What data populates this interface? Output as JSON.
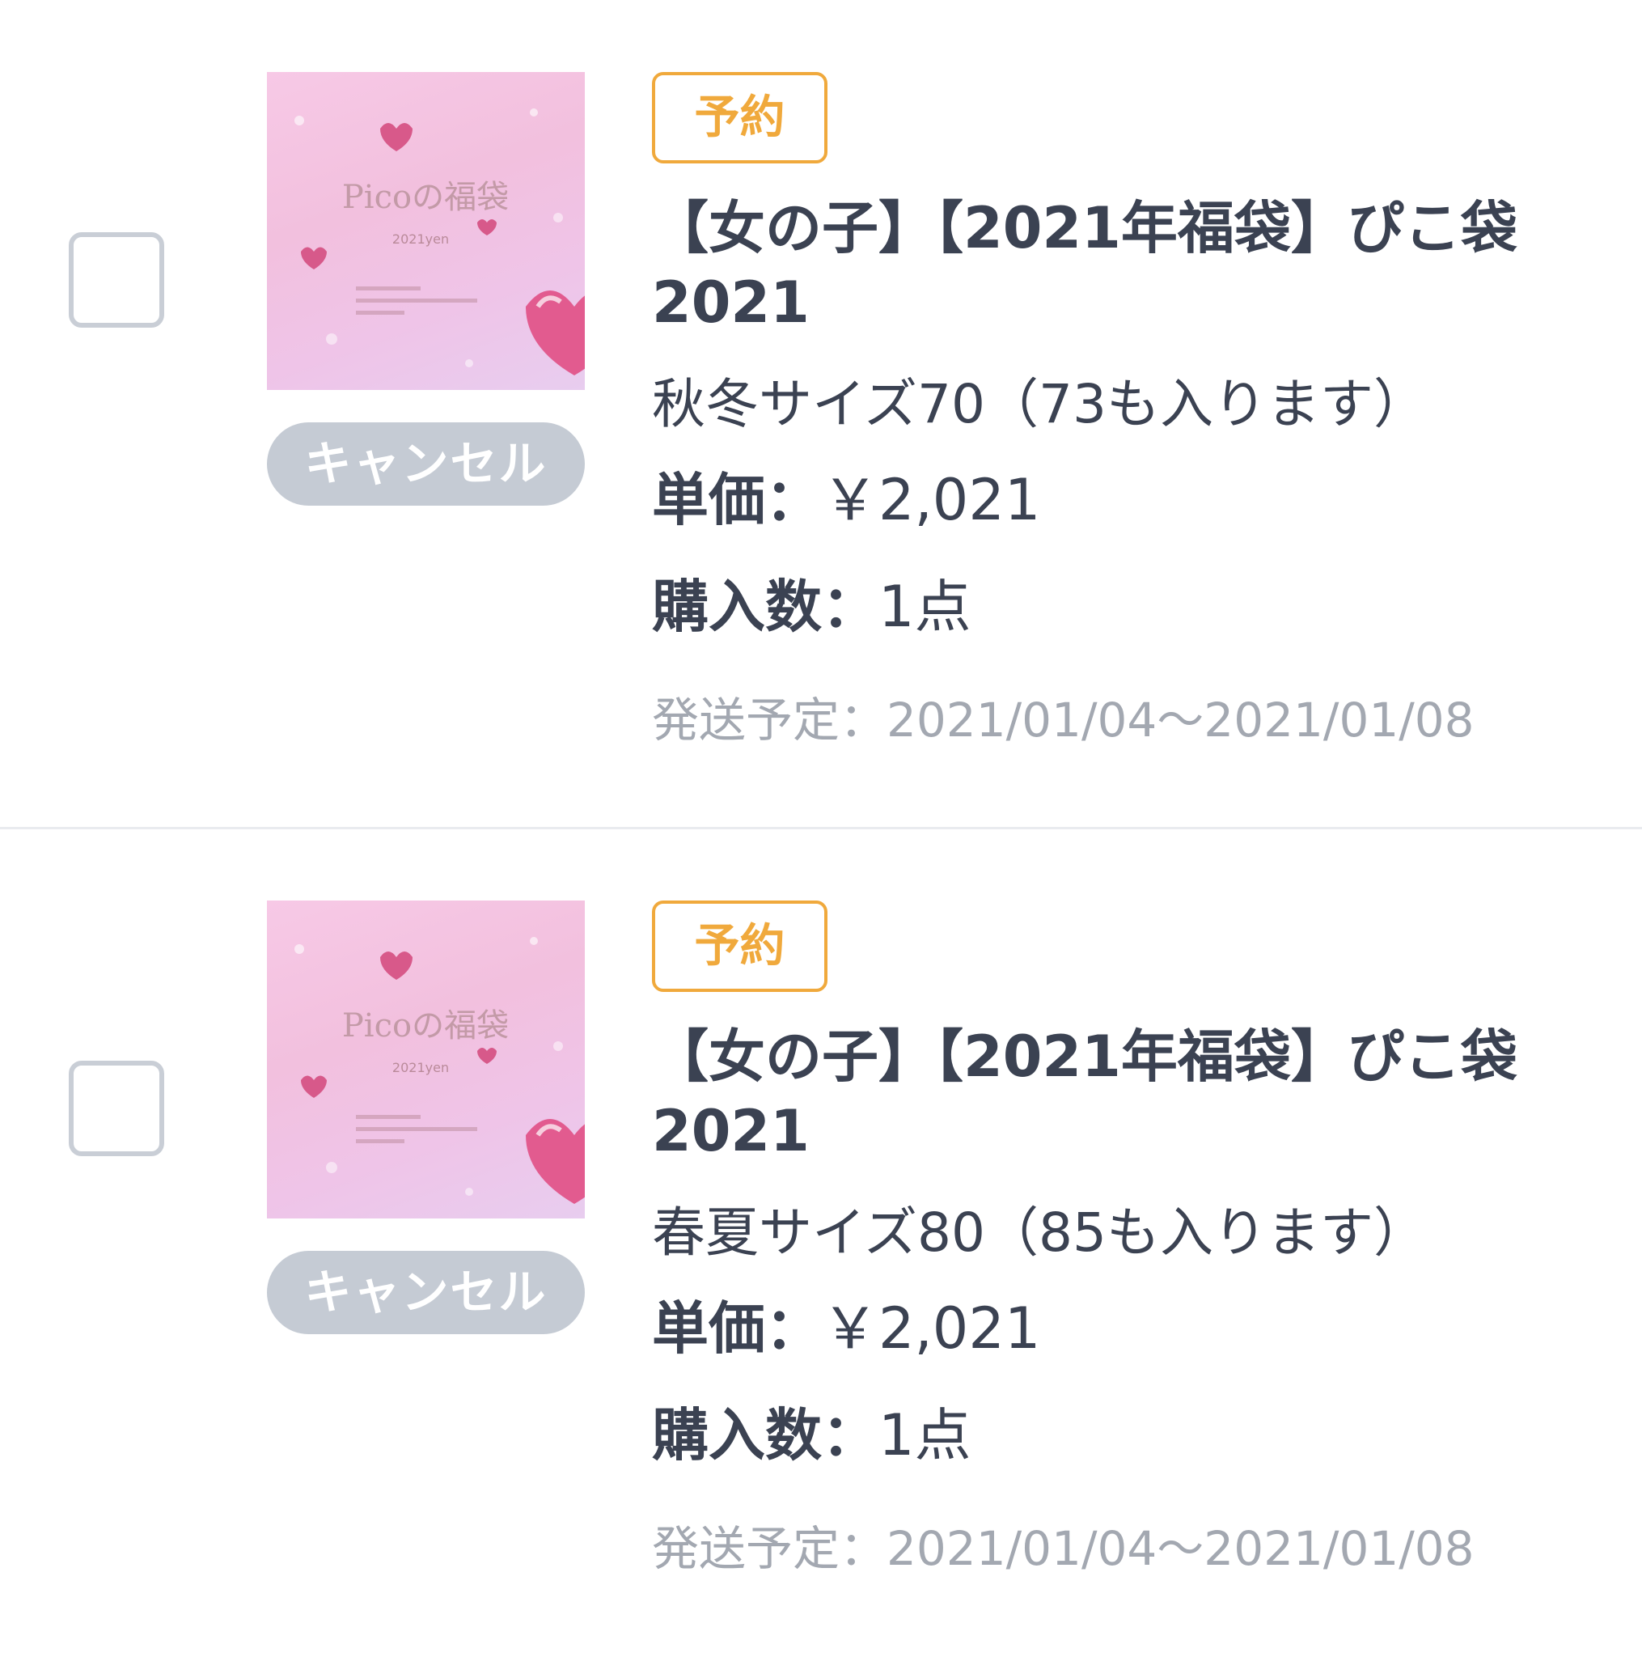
{
  "orders": [
    {
      "tag": "予約",
      "title": "【女の子】【2021年福袋】ぴこ袋2021",
      "variant": "秋冬サイズ70（73も入ります）",
      "price_label": "単価：",
      "price_value": "￥2,021",
      "qty_label": "購入数：",
      "qty_value": "1点",
      "ship": "発送予定：2021/01/04〜2021/01/08",
      "cancel_label": "キャンセル",
      "image": {
        "brand_text": "Picoの福袋",
        "year_text": "2021yen"
      }
    },
    {
      "tag": "予約",
      "title": "【女の子】【2021年福袋】ぴこ袋2021",
      "variant": "春夏サイズ80（85も入ります）",
      "price_label": "単価：",
      "price_value": "￥2,021",
      "qty_label": "購入数：",
      "qty_value": "1点",
      "ship": "発送予定：2021/01/04〜2021/01/08",
      "cancel_label": "キャンセル",
      "image": {
        "brand_text": "Picoの福袋",
        "year_text": "2021yen"
      }
    }
  ],
  "colors": {
    "tag_accent": "#f0a93c",
    "text_primary": "#3b4252",
    "text_muted": "#a3a8b1",
    "cancel_bg": "#c5cbd4",
    "checkbox_border": "#c9ced6",
    "thumb_pink": "#f2c0de"
  }
}
